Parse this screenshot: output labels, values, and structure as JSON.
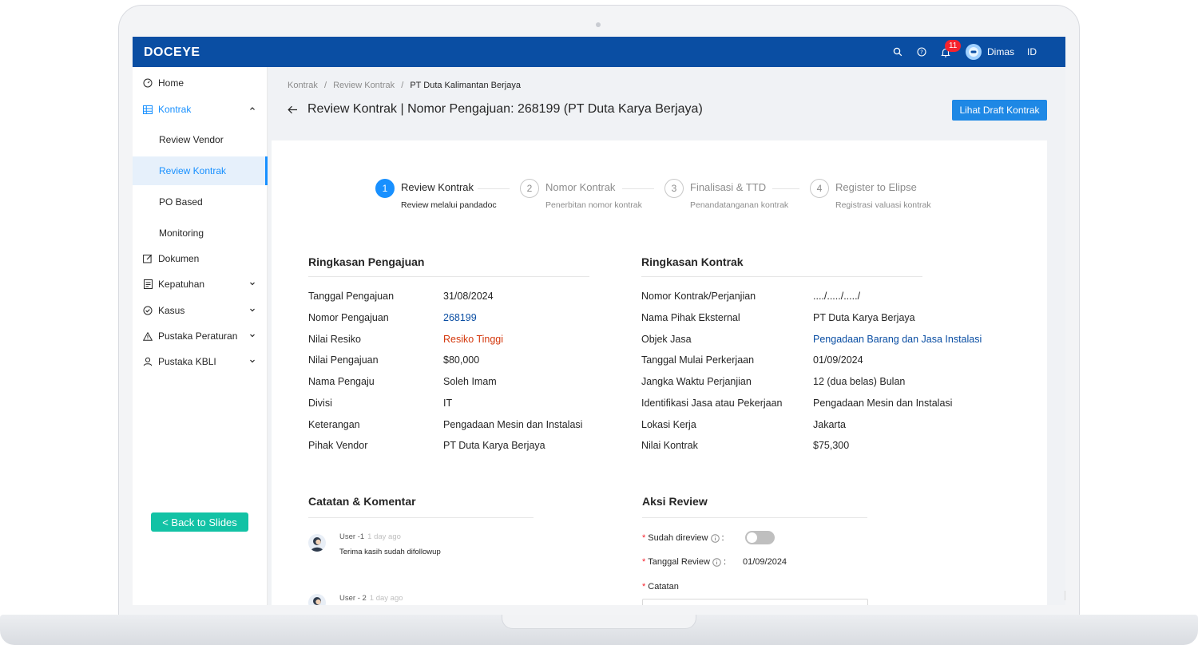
{
  "app": {
    "logo": "DOCEYE"
  },
  "topbar": {
    "notification_count": "11",
    "user_name": "Dimas",
    "language": "ID"
  },
  "sidebar": {
    "home": "Home",
    "kontrak": "Kontrak",
    "review_vendor": "Review Vendor",
    "review_kontrak": "Review Kontrak",
    "po_based": "PO Based",
    "monitoring": "Monitoring",
    "dokumen": "Dokumen",
    "kepatuhan": "Kepatuhan",
    "kasus": "Kasus",
    "pustaka_peraturan": "Pustaka Peraturan",
    "pustaka_kbli": "Pustaka KBLI",
    "back_button": "< Back to Slides"
  },
  "breadcrumb": {
    "item1": "Kontrak",
    "item2": "Review Kontrak",
    "current": "PT Duta Kalimantan Berjaya",
    "sep": "/"
  },
  "header": {
    "title": "Review Kontrak | Nomor Pengajuan: 268199 (PT Duta Karya Berjaya)",
    "draft_button": "Lihat Draft Kontrak"
  },
  "steps": [
    {
      "num": "1",
      "title": "Review Kontrak",
      "desc": "Review melalui pandadoc"
    },
    {
      "num": "2",
      "title": "Nomor Kontrak",
      "desc": "Penerbitan nomor kontrak"
    },
    {
      "num": "3",
      "title": "Finalisasi & TTD",
      "desc": "Penandatanganan kontrak"
    },
    {
      "num": "4",
      "title": "Register to Elipse",
      "desc": "Registrasi valuasi kontrak"
    }
  ],
  "ringkasan_pengajuan": {
    "title": "Ringkasan Pengajuan",
    "rows": [
      {
        "label": "Tanggal Pengajuan",
        "value": "31/08/2024"
      },
      {
        "label": "Nomor Pengajuan",
        "value": "268199"
      },
      {
        "label": "Nilai Resiko",
        "value": "Resiko Tinggi"
      },
      {
        "label": "Nilai Pengajuan",
        "value": "$80,000"
      },
      {
        "label": "Nama Pengaju",
        "value": "Soleh Imam"
      },
      {
        "label": "Divisi",
        "value": "IT"
      },
      {
        "label": "Keterangan",
        "value": "Pengadaan Mesin dan Instalasi"
      },
      {
        "label": "Pihak Vendor",
        "value": "PT Duta Karya Berjaya"
      }
    ]
  },
  "ringkasan_kontrak": {
    "title": "Ringkasan Kontrak",
    "rows": [
      {
        "label": "Nomor Kontrak/Perjanjian",
        "value": "..../...../...../"
      },
      {
        "label": "Nama Pihak Eksternal",
        "value": "PT Duta Karya Berjaya"
      },
      {
        "label": "Objek Jasa",
        "value": "Pengadaan Barang dan Jasa Instalasi"
      },
      {
        "label": "Tanggal Mulai Perkerjaan",
        "value": "01/09/2024"
      },
      {
        "label": "Jangka Waktu Perjanjian",
        "value": "12 (dua belas) Bulan"
      },
      {
        "label": "Identifikasi Jasa atau Pekerjaan",
        "value": "Pengadaan Mesin dan Instalasi"
      },
      {
        "label": "Lokasi Kerja",
        "value": "Jakarta"
      },
      {
        "label": "Nilai Kontrak",
        "value": "$75,300"
      }
    ]
  },
  "catatan": {
    "title": "Catatan & Komentar",
    "comments": [
      {
        "user": "User -1",
        "time": "1 day ago",
        "text": "Terima kasih sudah difollowup"
      },
      {
        "user": "User - 2",
        "time": "1 day ago"
      }
    ]
  },
  "aksi_review": {
    "title": "Aksi Review",
    "sudah_direview_label": "Sudah direview",
    "tanggal_review_label": "Tanggal Review",
    "tanggal_review_value": "01/09/2024",
    "catatan_label": "Catatan",
    "required_mark": "*",
    "colon": ":"
  },
  "colors": {
    "primary": "#0a4ea3",
    "accent": "#1890ff",
    "risk": "#d4380d",
    "back_button": "#12c2a5"
  }
}
